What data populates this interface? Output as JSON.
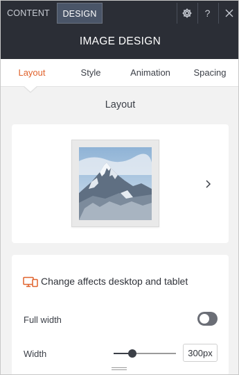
{
  "top_tabs": [
    {
      "label": "CONTENT",
      "active": false
    },
    {
      "label": "DESIGN",
      "active": true
    }
  ],
  "top_icons": [
    "gear-icon",
    "help-icon",
    "close-icon"
  ],
  "help_glyph": "?",
  "header": {
    "title": "IMAGE DESIGN"
  },
  "sub_tabs": [
    {
      "label": "Layout",
      "active": true
    },
    {
      "label": "Style",
      "active": false
    },
    {
      "label": "Animation",
      "active": false
    },
    {
      "label": "Spacing",
      "active": false
    }
  ],
  "section": {
    "title": "Layout"
  },
  "layout_preview": {
    "thumbnail": "mountain-image",
    "next_icon": "chevron-right-icon"
  },
  "settings": {
    "affects_text": "Change affects desktop and tablet",
    "affects_icon": "desktop-tablet-icon",
    "full_width": {
      "label": "Full width",
      "enabled": false
    },
    "width": {
      "label": "Width",
      "value": "300px",
      "slider_fraction": 0.3
    }
  },
  "colors": {
    "accent": "#e0622c",
    "topbar": "#2b2e36",
    "panel_bg": "#f2f2f2"
  }
}
